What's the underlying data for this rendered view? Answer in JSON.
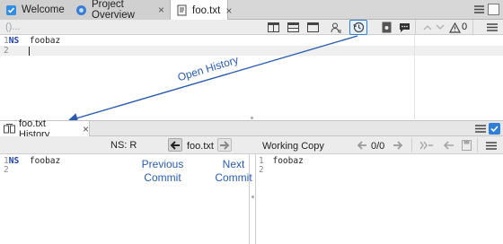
{
  "tabs": [
    {
      "label": "Welcome",
      "icon": "welcome-icon",
      "active": false
    },
    {
      "label": "Project Overview",
      "icon": "project-overview-icon",
      "active": false
    },
    {
      "label": "foo.txt",
      "icon": "text-file-icon",
      "active": true
    }
  ],
  "editor": {
    "breadcrumb": "()...",
    "warnings_count": "0",
    "lines": [
      {
        "num": "1",
        "ns": "NS",
        "text": "foobaz"
      },
      {
        "num": "2",
        "ns": "",
        "text": ""
      }
    ]
  },
  "annotations": {
    "open_history": "Open History",
    "previous_commit_line1": "Previous",
    "previous_commit_line2": "Commit",
    "next_commit_line1": "Next",
    "next_commit_line2": "Commit"
  },
  "history": {
    "tab_label": "foo.txt History",
    "ns_label": "NS: R",
    "file_label": "foo.txt",
    "working_copy_label": "Working Copy",
    "diff_counter": "0/0",
    "left_lines": [
      {
        "num": "1",
        "ns": "NS",
        "text": "foobaz"
      },
      {
        "num": "2",
        "ns": "",
        "text": ""
      }
    ],
    "right_lines": [
      {
        "num": "1",
        "text": "foobaz"
      },
      {
        "num": "2",
        "text": ""
      }
    ]
  },
  "colors": {
    "annotation_blue": "#2a5db0",
    "highlight_border": "#2f7fd8"
  }
}
